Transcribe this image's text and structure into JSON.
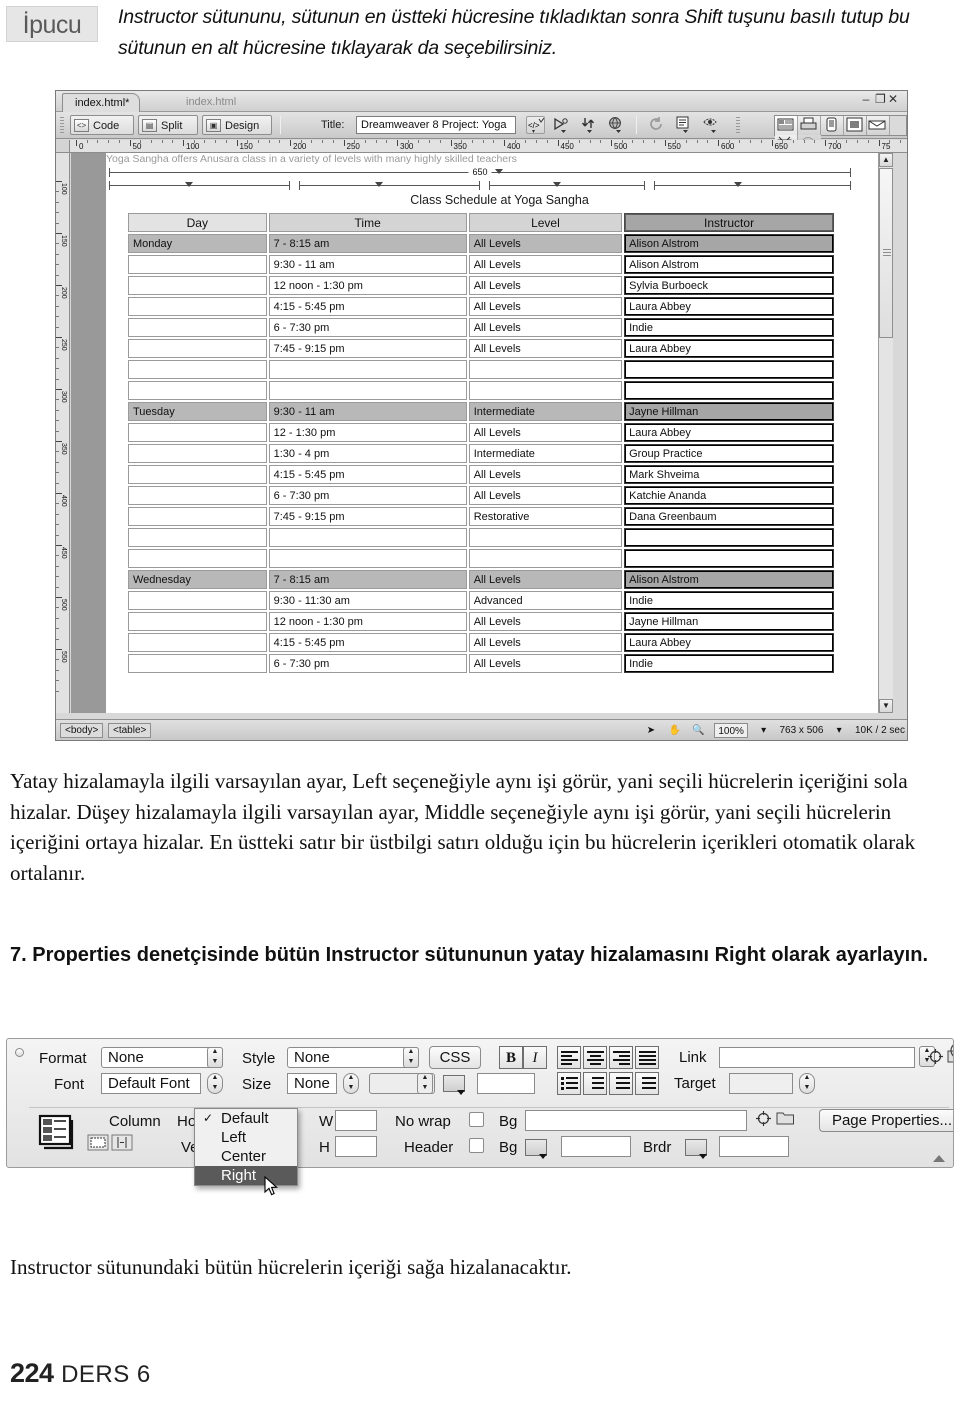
{
  "tip": {
    "badge": "İpucu",
    "text": "Instructor sütununu, sütunun en üstteki hücresine tıkladıktan sonra Shift tuşunu basılı tutup bu sütunun en alt hücresine tıklayarak da seçebilirsiniz."
  },
  "dreamweaver": {
    "tabs": [
      {
        "label": "index.html*",
        "active": true
      },
      {
        "label": "index.html",
        "active": false
      }
    ],
    "window_buttons": {
      "minimize": "–",
      "restore": "❐",
      "close": "✕"
    },
    "toolbar": {
      "code_label": "Code",
      "split_label": "Split",
      "design_label": "Design",
      "title_label": "Title:",
      "title_value": "Dreamweaver 8 Project: Yoga"
    },
    "ruler_h_labels": [
      "0",
      "50",
      "100",
      "150",
      "200",
      "250",
      "300",
      "350",
      "400",
      "450",
      "500",
      "550",
      "600",
      "650",
      "700",
      "75"
    ],
    "ruler_v_labels": [
      "100",
      "150",
      "200",
      "250",
      "300",
      "350",
      "400",
      "450",
      "500",
      "550"
    ],
    "document": {
      "intro_line": "Yoga Sangha offers Anusara class in a variety of levels with many highly skilled teachers",
      "table_width_label": "650",
      "caption": "Class Schedule at Yoga Sangha",
      "headers": [
        "Day",
        "Time",
        "Level",
        "Instructor"
      ],
      "rows": [
        {
          "day": "Monday",
          "time": "7 - 8:15 am",
          "level": "All Levels",
          "instructor": "Alison Alstrom",
          "header_row": true
        },
        {
          "day": "",
          "time": "9:30 - 11 am",
          "level": "All Levels",
          "instructor": "Alison Alstrom",
          "header_row": false
        },
        {
          "day": "",
          "time": "12 noon - 1:30 pm",
          "level": "All Levels",
          "instructor": "Sylvia Burboeck",
          "header_row": false
        },
        {
          "day": "",
          "time": "4:15 - 5:45 pm",
          "level": "All Levels",
          "instructor": "Laura Abbey",
          "header_row": false
        },
        {
          "day": "",
          "time": "6 - 7:30 pm",
          "level": "All Levels",
          "instructor": "Indie",
          "header_row": false
        },
        {
          "day": "",
          "time": "7:45 - 9:15 pm",
          "level": "All Levels",
          "instructor": "Laura Abbey",
          "header_row": false
        },
        {
          "day": "",
          "time": "",
          "level": "",
          "instructor": "",
          "header_row": false
        },
        {
          "day": "",
          "time": "",
          "level": "",
          "instructor": "",
          "header_row": false
        },
        {
          "day": "Tuesday",
          "time": "9:30 - 11 am",
          "level": "Intermediate",
          "instructor": "Jayne Hillman",
          "header_row": true
        },
        {
          "day": "",
          "time": "12 - 1:30 pm",
          "level": "All Levels",
          "instructor": "Laura Abbey",
          "header_row": false
        },
        {
          "day": "",
          "time": "1:30 - 4 pm",
          "level": "Intermediate",
          "instructor": "Group Practice",
          "header_row": false
        },
        {
          "day": "",
          "time": "4:15 - 5:45 pm",
          "level": "All Levels",
          "instructor": "Mark Shveima",
          "header_row": false
        },
        {
          "day": "",
          "time": "6 - 7:30 pm",
          "level": "All Levels",
          "instructor": "Katchie Ananda",
          "header_row": false
        },
        {
          "day": "",
          "time": "7:45 - 9:15 pm",
          "level": "Restorative",
          "instructor": "Dana Greenbaum",
          "header_row": false
        },
        {
          "day": "",
          "time": "",
          "level": "",
          "instructor": "",
          "header_row": false
        },
        {
          "day": "",
          "time": "",
          "level": "",
          "instructor": "",
          "header_row": false
        },
        {
          "day": "Wednesday",
          "time": "7 - 8:15 am",
          "level": "All Levels",
          "instructor": "Alison Alstrom",
          "header_row": true
        },
        {
          "day": "",
          "time": "9:30 - 11:30 am",
          "level": "Advanced",
          "instructor": "Indie",
          "header_row": false
        },
        {
          "day": "",
          "time": "12 noon - 1:30 pm",
          "level": "All Levels",
          "instructor": "Jayne Hillman",
          "header_row": false
        },
        {
          "day": "",
          "time": "4:15 - 5:45 pm",
          "level": "All Levels",
          "instructor": "Laura Abbey",
          "header_row": false
        },
        {
          "day": "",
          "time": "6 - 7:30 pm",
          "level": "All Levels",
          "instructor": "Indie",
          "header_row": false
        }
      ]
    },
    "status_bar": {
      "tag_body": "<body>",
      "tag_table": "<table>",
      "zoom": "100%",
      "dimensions": "763 x 506",
      "weight": "10K / 2 sec"
    }
  },
  "body_text": {
    "para1": "Yatay hizalamayla ilgili varsayılan ayar, Left seçeneğiyle aynı işi görür, yani seçili hücrelerin içeriğini sola hizalar. Düşey hizalamayla ilgili varsayılan ayar, Middle seçeneğiyle aynı işi görür, yani seçili hücrelerin içeriğini ortaya hizalar. En üstteki satır bir üstbilgi satırı olduğu için bu hücrelerin içerikleri otomatik olarak ortalanır.",
    "step_number": "7.",
    "step_text": "Properties denetçisinde bütün Instructor sütununun yatay hizalamasını Right olarak ayarlayın.",
    "para2": "Instructor sütunundaki bütün hücrelerin içeriği sağa hizalanacaktır."
  },
  "properties": {
    "format_label": "Format",
    "format_value": "None",
    "style_label": "Style",
    "style_value": "None",
    "css_button": "CSS",
    "bold_button": "B",
    "italic_button": "I",
    "link_label": "Link",
    "link_value": "",
    "font_label": "Font",
    "font_value": "Default Font",
    "size_label": "Size",
    "size_value": "None",
    "size_unit_value": "",
    "color_value": "",
    "target_label": "Target",
    "target_value": "",
    "column_label": "Column",
    "horz_label": "Horz",
    "vert_label": "Vert",
    "w_label": "W",
    "w_value": "",
    "h_label": "H",
    "h_value": "",
    "nowrap_label": "No wrap",
    "header_label": "Header",
    "bg_label_1": "Bg",
    "bg_value_1": "",
    "bg_label_2": "Bg",
    "bg_value_2": "",
    "brdr_label": "Brdr",
    "brdr_value": "",
    "page_properties_button": "Page Properties...",
    "help_icon": "?",
    "align_menu": {
      "items": [
        {
          "label": "Default",
          "checked": true,
          "selected": false
        },
        {
          "label": "Left",
          "checked": false,
          "selected": false
        },
        {
          "label": "Center",
          "checked": false,
          "selected": false
        },
        {
          "label": "Right",
          "checked": false,
          "selected": true
        }
      ]
    }
  },
  "footer": {
    "page_number": "224",
    "label": "DERS 6"
  }
}
